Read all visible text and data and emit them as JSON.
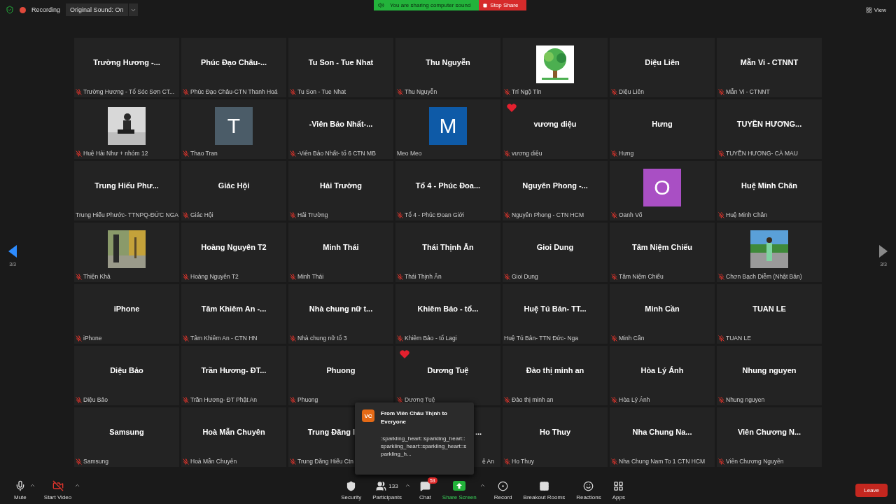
{
  "top_bar": {
    "recording": "Recording",
    "sound_dropdown": "Original Sound: On",
    "sharing_notice": "You are sharing computer sound",
    "stop_share": "Stop Share",
    "view": "View"
  },
  "pager": {
    "left": "3/3",
    "right": "3/3"
  },
  "tiles": [
    {
      "kind": "name",
      "name": "Trường Hương -...",
      "label": "Trường Hương - Tổ Sóc Sơn CT...",
      "muted": true,
      "heart": false
    },
    {
      "kind": "name",
      "name": "Phúc Đạo Châu-...",
      "label": "Phúc Đạo Châu-CTN Thanh Hoá",
      "muted": true,
      "heart": false
    },
    {
      "kind": "name",
      "name": "Tu Son - Tue Nhat",
      "label": "Tu Son - Tue Nhat",
      "muted": true,
      "heart": false
    },
    {
      "kind": "name",
      "name": "Thu Nguyễn",
      "label": "Thu Nguyễn",
      "muted": true,
      "heart": false
    },
    {
      "kind": "picture",
      "label": "Trí Ngộ Tín",
      "muted": true,
      "heart": false
    },
    {
      "kind": "name",
      "name": "Diệu Liên",
      "label": "Diệu Liên",
      "muted": true,
      "heart": false
    },
    {
      "kind": "name",
      "name": "Mẫn Vi - CTNNT",
      "label": "Mẫn Vi - CTNNT",
      "muted": true,
      "heart": false
    },
    {
      "kind": "picture",
      "label": "Huệ Hải Như + nhóm 12",
      "muted": true,
      "heart": false
    },
    {
      "kind": "letter",
      "letter": "T",
      "color": "#4b5c68",
      "label": "Thao Tran",
      "muted": true,
      "heart": false
    },
    {
      "kind": "name",
      "name": "-Viên Bảo Nhất-...",
      "label": "-Viên Bảo Nhất- tổ 6 CTN MB",
      "muted": true,
      "heart": false
    },
    {
      "kind": "letter",
      "letter": "M",
      "color": "#0e5aa7",
      "label": "Meo Meo",
      "muted": false,
      "heart": false
    },
    {
      "kind": "name",
      "name": "vương diệu",
      "label": "vương diệu",
      "muted": true,
      "heart": true
    },
    {
      "kind": "name",
      "name": "Hưng",
      "label": "Hưng",
      "muted": true,
      "heart": false
    },
    {
      "kind": "name",
      "name": "TUYỀN HƯƠNG...",
      "label": "TUYỀN HƯƠNG- CÀ MAU",
      "muted": true,
      "heart": false
    },
    {
      "kind": "name",
      "name": "Trung Hiếu Phư...",
      "label": "Trung Hiếu Phước- TTNPQ-ĐỨC NGA",
      "muted": false,
      "heart": false
    },
    {
      "kind": "name",
      "name": "Giác Hội",
      "label": "Giác Hội",
      "muted": true,
      "heart": false
    },
    {
      "kind": "name",
      "name": "Hải Trường",
      "label": "Hải Trường",
      "muted": true,
      "heart": false
    },
    {
      "kind": "name",
      "name": "Tổ 4 - Phúc Đoa...",
      "label": "Tổ 4 - Phúc Đoan Giới",
      "muted": true,
      "heart": false
    },
    {
      "kind": "name",
      "name": "Nguyên Phong -...",
      "label": "Nguyên Phong - CTN HCM",
      "muted": true,
      "heart": false
    },
    {
      "kind": "letter",
      "letter": "O",
      "color": "#a94fc4",
      "label": "Oanh Võ",
      "muted": true,
      "heart": false
    },
    {
      "kind": "name",
      "name": "Huệ Minh Chân",
      "label": "Huệ Minh Chân",
      "muted": true,
      "heart": false
    },
    {
      "kind": "picture",
      "label": "Thiện Khả",
      "muted": true,
      "heart": false
    },
    {
      "kind": "name",
      "name": "Hoàng Nguyên T2",
      "label": "Hoàng Nguyên T2",
      "muted": true,
      "heart": false
    },
    {
      "kind": "name",
      "name": "Minh Thái",
      "label": "Minh Thái",
      "muted": true,
      "heart": false
    },
    {
      "kind": "name",
      "name": "Thái Thịnh Ân",
      "label": "Thái Thịnh Ân",
      "muted": true,
      "heart": false
    },
    {
      "kind": "name",
      "name": "Gioi Dung",
      "label": "Gioi Dung",
      "muted": true,
      "heart": false
    },
    {
      "kind": "name",
      "name": "Tâm Niệm Chiếu",
      "label": "Tâm Niệm Chiếu",
      "muted": true,
      "heart": false
    },
    {
      "kind": "picture",
      "label": "Chơn Bạch Diễm (Nhật Bản)",
      "muted": true,
      "heart": false
    },
    {
      "kind": "name",
      "name": "iPhone",
      "label": "iPhone",
      "muted": true,
      "heart": false
    },
    {
      "kind": "name",
      "name": "Tâm Khiêm An -...",
      "label": "Tâm Khiêm An - CTN HN",
      "muted": true,
      "heart": false
    },
    {
      "kind": "name",
      "name": "Nhà chung nữ t...",
      "label": "Nhà chung nữ tổ 3",
      "muted": true,
      "heart": false
    },
    {
      "kind": "name",
      "name": "Khiêm Bảo - tổ...",
      "label": "Khiêm Bảo - tổ Lagi",
      "muted": true,
      "heart": false
    },
    {
      "kind": "name",
      "name": "Huệ Tú Bản- TT...",
      "label": "Huệ Tú Bản- TTN Đức- Nga",
      "muted": false,
      "heart": false
    },
    {
      "kind": "name",
      "name": "Minh Cần",
      "label": "Minh Cần",
      "muted": true,
      "heart": false
    },
    {
      "kind": "name",
      "name": "TUAN LE",
      "label": "TUAN LE",
      "muted": true,
      "heart": false
    },
    {
      "kind": "name",
      "name": "Diệu Bảo",
      "label": "Diệu Bảo",
      "muted": true,
      "heart": false
    },
    {
      "kind": "name",
      "name": "Trần Hương- ĐT...",
      "label": "Trần Hương- ĐT Phật An",
      "muted": true,
      "heart": false
    },
    {
      "kind": "name",
      "name": "Phuong",
      "label": "Phuong",
      "muted": true,
      "heart": false
    },
    {
      "kind": "name",
      "name": "Dương Tuệ",
      "label": "Dương Tuệ",
      "muted": true,
      "heart": true
    },
    {
      "kind": "name",
      "name": "Đào thị minh an",
      "label": "Đào thị minh an",
      "muted": true,
      "heart": false
    },
    {
      "kind": "name",
      "name": "Hòa Lý Ánh",
      "label": "Hòa Lý Ánh",
      "muted": true,
      "heart": false
    },
    {
      "kind": "name",
      "name": "Nhung nguyen",
      "label": "Nhung nguyen",
      "muted": true,
      "heart": false
    },
    {
      "kind": "name",
      "name": "Samsung",
      "label": "Samsung",
      "muted": true,
      "heart": false
    },
    {
      "kind": "name",
      "name": "Hoà Mẫn Chuyên",
      "label": "Hoà Mẫn Chuyên",
      "muted": true,
      "heart": false
    },
    {
      "kind": "name",
      "name": "Trung Đăng I",
      "label": "Trung Đăng Hiếu Ctn",
      "muted": true,
      "heart": false,
      "hidden_right": true
    },
    {
      "kind": "name",
      "name": "...",
      "label": "ệ An",
      "hidden_left": true
    },
    {
      "kind": "name",
      "name": "Ho Thuy",
      "label": "Ho Thuy",
      "muted": true,
      "heart": false
    },
    {
      "kind": "name",
      "name": "Nha Chung Na...",
      "label": "Nha Chung Nam To 1 CTN HCM",
      "muted": true,
      "heart": false
    },
    {
      "kind": "name",
      "name": "Viên Chương N...",
      "label": "Viên Chương Nguyên",
      "muted": true,
      "heart": false
    }
  ],
  "chat_popup": {
    "avatar": "VC",
    "from": "From Viên Châu Thịnh to Everyone",
    "message": ":sparkling_heart::sparkling_heart::sparkling_heart::sparkling_heart::sparkling_h..."
  },
  "toolbar": [
    {
      "kind": "mute",
      "label": "Mute",
      "caret": true
    },
    {
      "kind": "video",
      "label": "Start Video",
      "caret": true
    },
    {
      "kind": "spacer"
    },
    {
      "kind": "security",
      "label": "Security",
      "caret": false
    },
    {
      "kind": "participants",
      "label": "Participants",
      "count": "133",
      "caret": true
    },
    {
      "kind": "chat",
      "label": "Chat",
      "badge": "53",
      "caret": false
    },
    {
      "kind": "share",
      "label": "Share Screen",
      "caret": true
    },
    {
      "kind": "record",
      "label": "Record",
      "caret": false
    },
    {
      "kind": "breakout",
      "label": "Breakout Rooms",
      "caret": false
    },
    {
      "kind": "reactions",
      "label": "Reactions",
      "caret": false
    },
    {
      "kind": "apps",
      "label": "Apps",
      "caret": false
    }
  ],
  "leave": "Leave"
}
